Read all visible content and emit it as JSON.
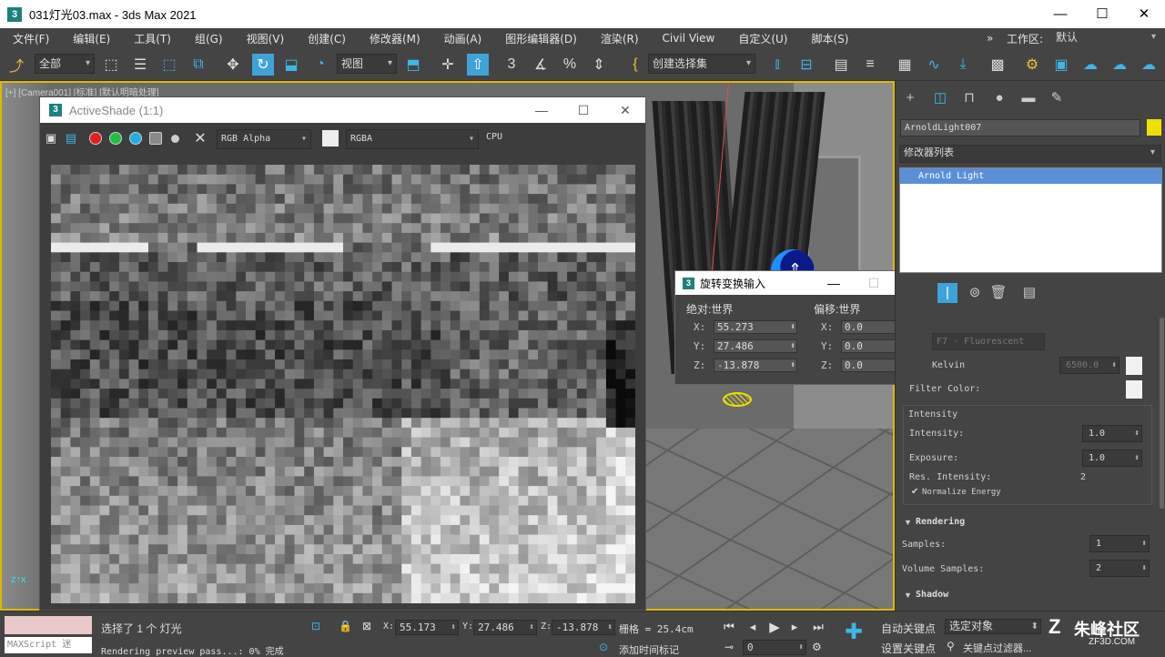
{
  "app": {
    "title": "031灯光03.max - 3ds Max 2021",
    "logo": "3"
  },
  "window_controls": {
    "minimize": "—",
    "maximize": "☐",
    "close": "✕"
  },
  "menu": [
    "文件(F)",
    "编辑(E)",
    "工具(T)",
    "组(G)",
    "视图(V)",
    "创建(C)",
    "修改器(M)",
    "动画(A)",
    "图形编辑器(D)",
    "渲染(R)",
    "Civil View",
    "自定义(U)",
    "脚本(S)"
  ],
  "menu_right": {
    "more": "»",
    "workspace_label": "工作区:",
    "workspace_value": "默认"
  },
  "toolbar": {
    "selection_filter": "全部",
    "ref_coord": "视图",
    "named_selection": "创建选择集",
    "snap_label": "3"
  },
  "viewport": {
    "label": "[+] [Camera001] [标准] [默认明暗处理]"
  },
  "activeshade": {
    "title": "ActiveShade (1:1)",
    "channel": "RGB Alpha",
    "mode": "RGBA",
    "device": "CPU"
  },
  "rotate_dialog": {
    "title": "旋转变换输入",
    "absolute": {
      "label": "绝对:世界",
      "x": "55.273",
      "y": "27.486",
      "z": "-13.878"
    },
    "offset": {
      "label": "偏移:世界",
      "x": "0.0",
      "y": "0.0",
      "z": "0.0"
    },
    "axis_labels": {
      "x": "X:",
      "y": "Y:",
      "z": "Z:"
    }
  },
  "command_panel": {
    "object_name": "ArnoldLight007",
    "object_color": "#f0e000",
    "modifier_list_label": "修改器列表",
    "stack_item": "Arnold Light",
    "preset": "F7 - Fluorescent",
    "kelvin_label": "Kelvin",
    "kelvin_value": "6500.0",
    "filter_color_label": "Filter Color:",
    "intensity_section": "Intensity",
    "intensity_label": "Intensity:",
    "intensity_value": "1.0",
    "exposure_label": "Exposure:",
    "exposure_value": "1.0",
    "res_intensity_label": "Res. Intensity:",
    "res_intensity_value": "2",
    "normalize_label": "Normalize Energy",
    "rendering_section": "Rendering",
    "samples_label": "Samples:",
    "samples_value": "1",
    "volume_samples_label": "Volume Samples:",
    "volume_samples_value": "2",
    "shadow_section": "Shadow"
  },
  "status": {
    "maxscript": "MAXScript 迷",
    "selection": "选择了 1 个 灯光",
    "progress_text": "Rendering preview pass...: 0% 完成",
    "x_label": "X:",
    "x": "55.173",
    "y_label": "Y:",
    "y": "27.486",
    "z_label": "Z:",
    "z": "-13.878",
    "grid": "栅格 = 25.4cm",
    "add_time_tag": "添加时间标记",
    "frame": "0",
    "auto_key": "自动关键点",
    "set_key": "设置关键点",
    "selected_object": "选定对象",
    "key_filter": "关键点过滤器..."
  },
  "watermark": {
    "brand": "朱峰社区",
    "url": "ZF3D.COM"
  }
}
